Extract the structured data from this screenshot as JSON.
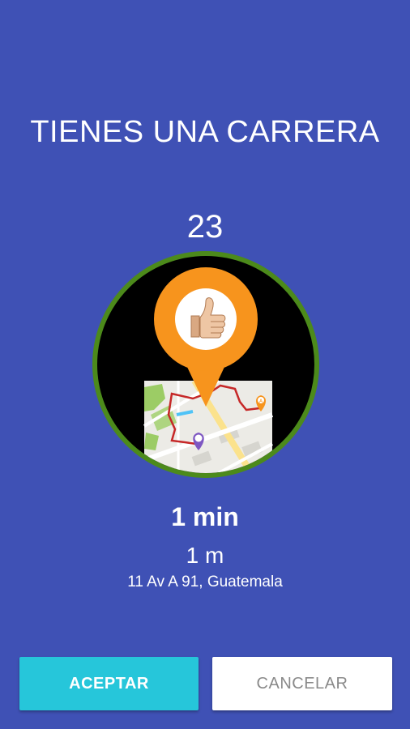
{
  "screen": {
    "title": "TIENES UNA CARRERA",
    "countdown": "23"
  },
  "illustration": {
    "icon": "map-pin-thumbs-up-icon",
    "colors": {
      "ring": "#4c8a1b",
      "pin": "#f7941d",
      "route": "#c62828"
    }
  },
  "trip": {
    "eta": "1 min",
    "distance": "1 m",
    "address": "11 Av A 91, Guatemala"
  },
  "actions": {
    "accept_label": "ACEPTAR",
    "cancel_label": "CANCELAR"
  },
  "theme": {
    "background": "#3f51b5",
    "accept_color": "#26c6da"
  }
}
